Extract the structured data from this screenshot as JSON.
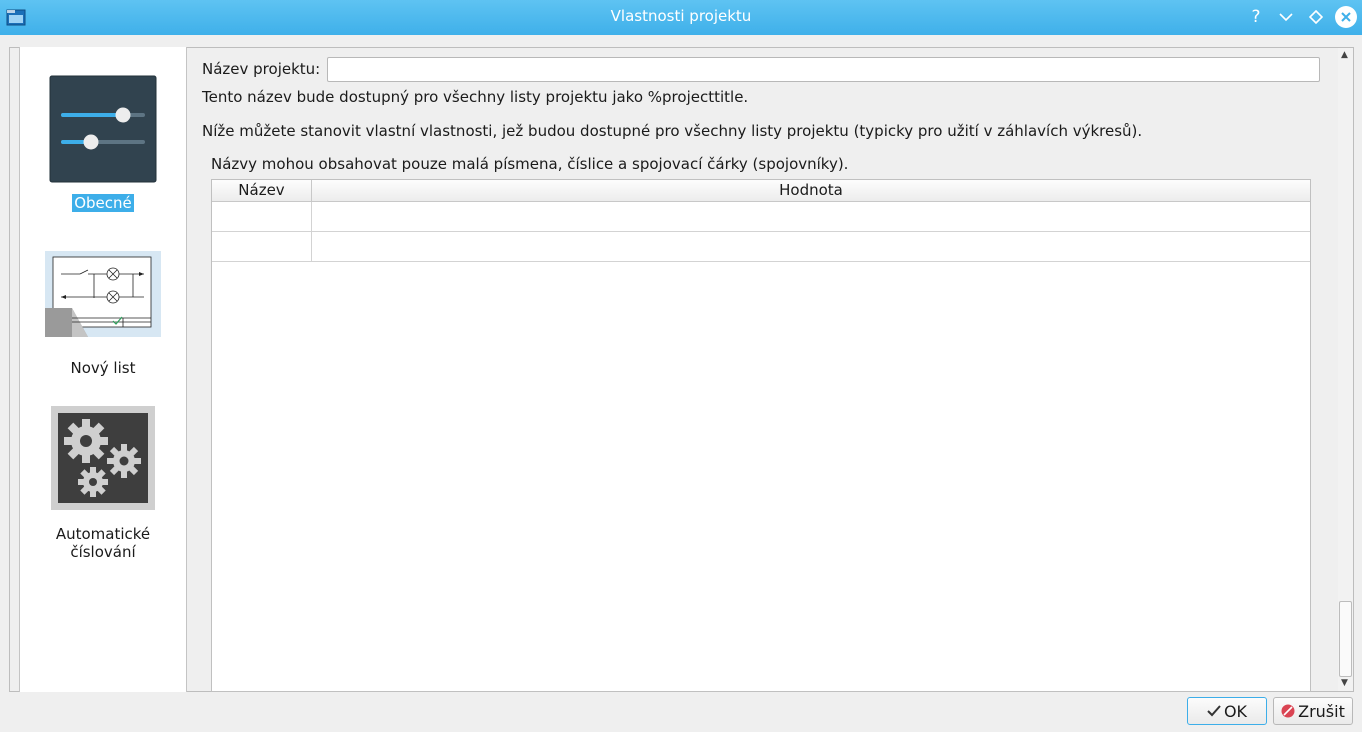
{
  "window": {
    "title": "Vlastnosti projektu",
    "accent_color": "#3daee9"
  },
  "sidebar": {
    "items": [
      {
        "label": "Obecné",
        "icon": "sliders-icon",
        "selected": true
      },
      {
        "label": "Nový list",
        "icon": "schematic-sheet-icon",
        "selected": false
      },
      {
        "label_line1": "Automatické",
        "label_line2": "číslování",
        "icon": "gears-icon",
        "selected": false
      }
    ]
  },
  "form": {
    "project_name_label": "Název projektu:",
    "project_name_value": "",
    "info_text": "Tento název bude dostupný pro všechny listy projektu jako %projecttitle.",
    "properties_text": "Níže můžete stanovit vlastní vlastnosti, jež budou dostupné pro všechny listy projektu (typicky pro užití v záhlavích výkresů).",
    "names_hint": "Názvy mohou obsahovat pouze malá písmena, číslice a spojovací čárky (spojovníky)."
  },
  "table": {
    "columns": [
      "Název",
      "Hodnota"
    ],
    "rows": [
      [
        "",
        ""
      ],
      [
        "",
        ""
      ]
    ]
  },
  "buttons": {
    "ok": "OK",
    "cancel": "Zrušit"
  }
}
